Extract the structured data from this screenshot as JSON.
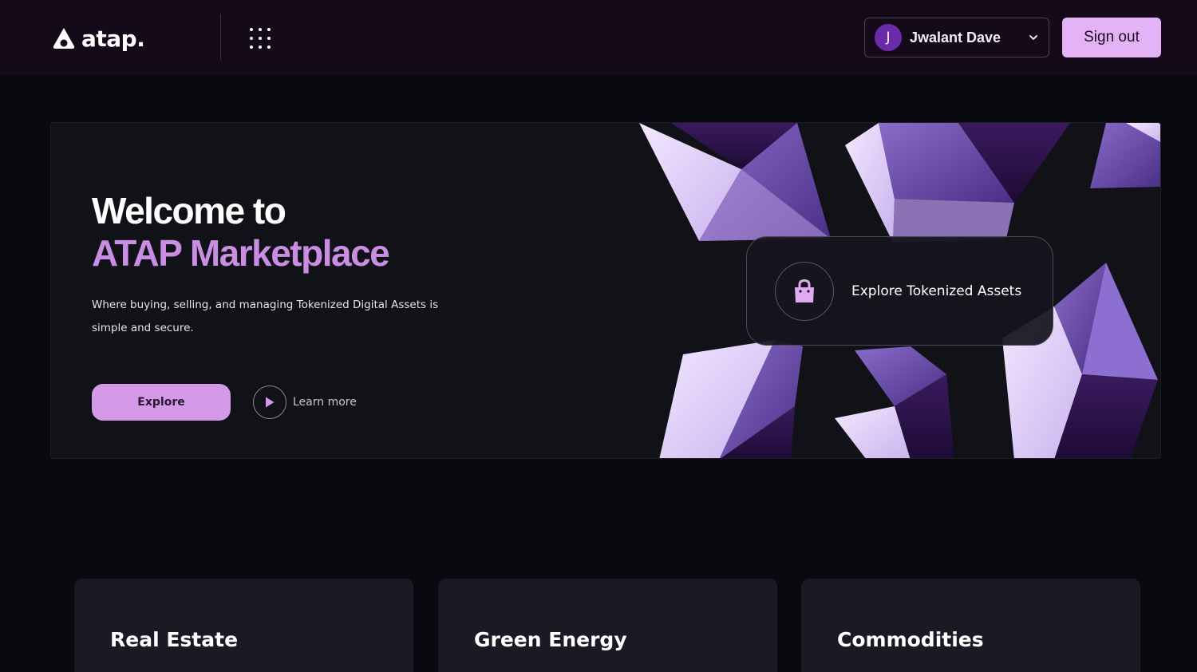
{
  "header": {
    "logo_text": "atap.",
    "user": {
      "initial": "J",
      "name": "Jwalant Dave"
    },
    "signout_label": "Sign out"
  },
  "hero": {
    "title_line1": "Welcome to",
    "title_line2": "ATAP Marketplace",
    "subtitle": "Where buying, selling, and managing Tokenized Digital Assets is simple and secure.",
    "explore_label": "Explore",
    "learn_more_label": "Learn more",
    "card_label": "Explore Tokenized Assets"
  },
  "categories": [
    {
      "title": "Real Estate"
    },
    {
      "title": "Green Energy"
    },
    {
      "title": "Commodities"
    }
  ],
  "colors": {
    "accent": "#d49ae8",
    "accent_text": "#c98ee3",
    "header_bg": "#150a1a",
    "page_bg": "#090a10",
    "avatar_bg": "#6b2aa8"
  },
  "icons": {
    "logo": "atap-logo-icon",
    "apps": "grid-icon",
    "chevron": "chevron-down-icon",
    "play": "play-icon",
    "bag": "shopping-bag-icon"
  }
}
